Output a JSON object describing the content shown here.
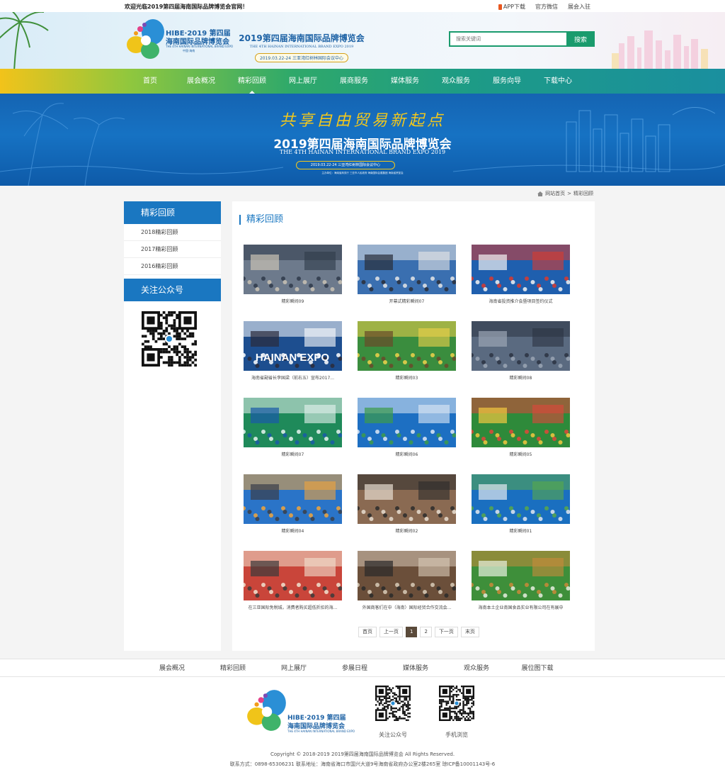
{
  "topbar": {
    "welcome": "欢迎光临2019第四届海南国际品牌博览会官网！",
    "app_download": "APP下载",
    "wechat": "官方微信",
    "exhibitor_login": "展会入驻"
  },
  "header": {
    "logo_line1": "HIBE·2019 第四届",
    "logo_line2": "海南国际品牌博览会",
    "logo_line3": "THE 4TH HAINAN INTERNATIONAL BRAND EXPO",
    "logo_line4": "中国·海南",
    "expo_cn": "2019第四届海南国际品牌博览会",
    "expo_en": "THE 4TH HAINAN INTERNATIONAL BRAND EXPO 2019",
    "expo_date": "2019.03.22-24 三亚湾红树林国际会议中心",
    "search_placeholder": "搜索关键词",
    "search_button": "搜索"
  },
  "nav": {
    "items": [
      "首页",
      "展会概况",
      "精彩回顾",
      "网上展厅",
      "展商服务",
      "媒体服务",
      "观众服务",
      "服务向导",
      "下载中心"
    ],
    "active_index": 2
  },
  "banner": {
    "slogan": "共享自由贸易新起点",
    "title_cn": "2019第四届海南国际品牌博览会",
    "title_en": "THE 4TH HAINAN INTERNATIONAL BRAND EXPO 2019",
    "date": "2019.03.22-24 三亚湾红树林国际会议中心",
    "organizers": "主办单位：海南省商务厅  三亚市人民政府  海南国际会展集团  海南省贸促会"
  },
  "breadcrumb": {
    "home": "网站首页",
    "sep": ">",
    "current": "精彩回顾"
  },
  "sidebar": {
    "title": "精彩回顾",
    "items": [
      "2018精彩回顾",
      "2017精彩回顾",
      "2016精彩回顾"
    ],
    "follow_title": "关注公众号"
  },
  "main": {
    "title": "精彩回顾",
    "gallery": [
      {
        "caption": "精彩瞬间09",
        "scene": "crowd-stage"
      },
      {
        "caption": "开幕式精彩瞬间07",
        "scene": "ceremony"
      },
      {
        "caption": "海南省投资推介会暨项目签约仪式",
        "scene": "signing"
      },
      {
        "caption": "海南省副省长李国梁（前右五）宣布2017...",
        "scene": "hainan-expo"
      },
      {
        "caption": "精彩瞬间03",
        "scene": "booth-green"
      },
      {
        "caption": "精彩瞬间08",
        "scene": "hall-crowd"
      },
      {
        "caption": "精彩瞬间07",
        "scene": "booth-hsf"
      },
      {
        "caption": "精彩瞬间06",
        "scene": "booth-blue"
      },
      {
        "caption": "精彩瞬间05",
        "scene": "booth-tropical"
      },
      {
        "caption": "精彩瞬间04",
        "scene": "booth-hall"
      },
      {
        "caption": "精彩瞬间02",
        "scene": "visitors"
      },
      {
        "caption": "精彩瞬间01",
        "scene": "booth-ring"
      },
      {
        "caption": "在三亚国际免税城，消费者购买超低折扣的海...",
        "scene": "shopping"
      },
      {
        "caption": "外国商客们在中（海南）国际经贸合作交流会...",
        "scene": "business"
      },
      {
        "caption": "海南本土企业南国食品实业有限公司在有展中",
        "scene": "food-booth"
      }
    ]
  },
  "pager": {
    "first": "首页",
    "prev": "上一页",
    "pages": [
      "1",
      "2"
    ],
    "current": "1",
    "next": "下一页",
    "last": "末页"
  },
  "footer": {
    "nav": [
      "展会概况",
      "精彩回顾",
      "网上展厅",
      "参展日程",
      "媒体服务",
      "观众服务",
      "展位图下载"
    ],
    "qr1_label": "关注公众号",
    "qr2_label": "手机浏览",
    "copyright": "Copyright © 2018-2019 2019第四届海南国际品牌博览会 All Rights Reserved.",
    "contact": "联系方式：0898-65306231 联系地址：海南省海口市国兴大道9号海南省政府办公室2楼265室 琼ICP备10001143号-6"
  },
  "colors": {
    "primary_blue": "#1a77c1",
    "green": "#1a9b6d",
    "pager_active": "#5a4a3a"
  }
}
